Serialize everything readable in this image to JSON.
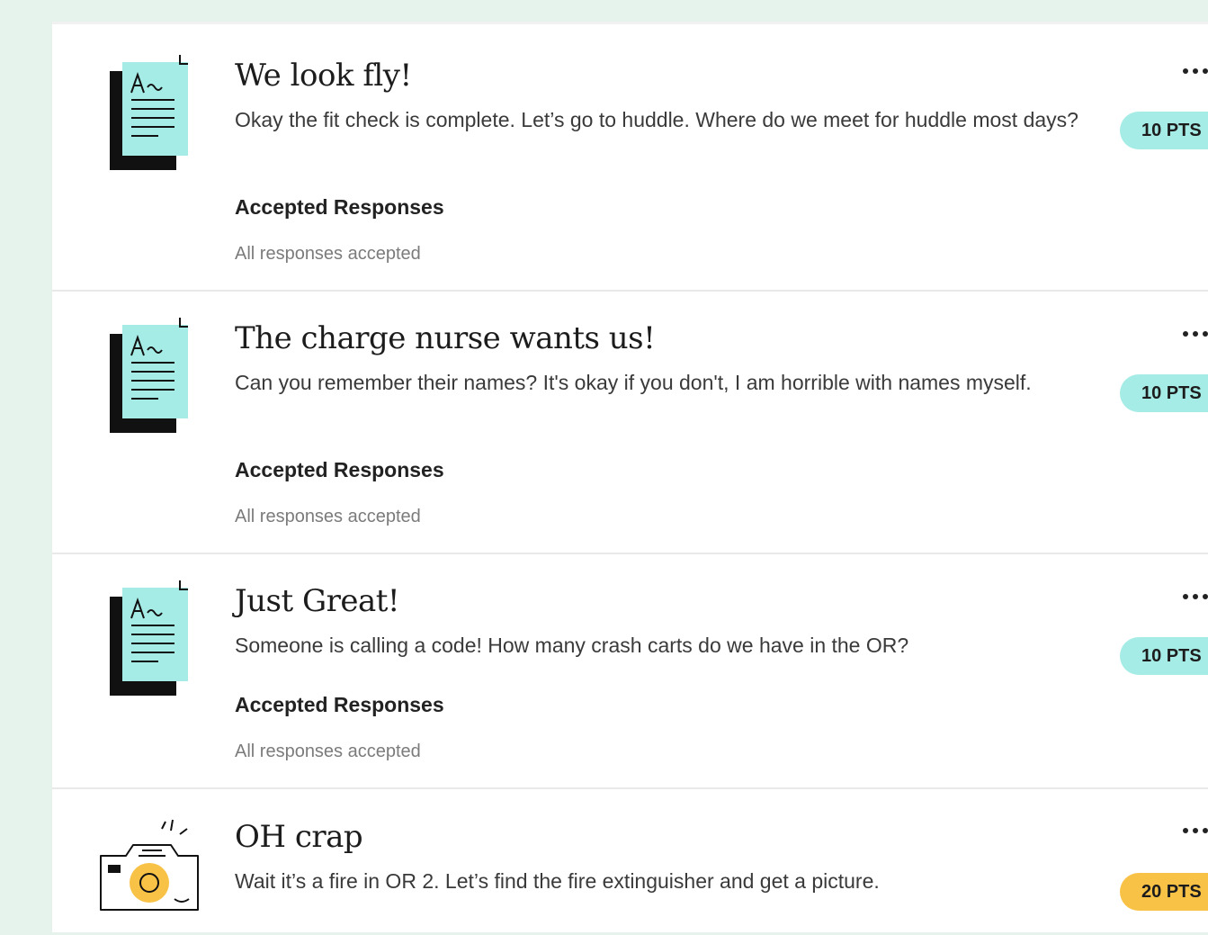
{
  "tasks": [
    {
      "title": "We look fly!",
      "description": "Okay the fit check is complete. Let’s go to huddle. Where do we meet for huddle most days?",
      "accepted_heading": "Accepted Responses",
      "accepted_text": "All responses accepted",
      "points": "10 PTS",
      "points_color": "#a6ece6",
      "icon": "document-icon"
    },
    {
      "title": "The charge nurse wants us!",
      "description": "Can you remember their names? It's okay if you don't, I am horrible with names myself.",
      "accepted_heading": "Accepted Responses",
      "accepted_text": "All responses accepted",
      "points": "10 PTS",
      "points_color": "#a6ece6",
      "icon": "document-icon"
    },
    {
      "title": "Just Great!",
      "description": "Someone is calling a code! How many crash carts do we have in the OR?",
      "accepted_heading": "Accepted Responses",
      "accepted_text": "All responses accepted",
      "points": "10 PTS",
      "points_color": "#a6ece6",
      "icon": "document-icon"
    },
    {
      "title": "OH crap",
      "description": "Wait it’s a fire in OR 2. Let’s find the fire extinguisher and get a picture.",
      "points": "20 PTS",
      "points_color": "#f8c247",
      "icon": "camera-icon"
    }
  ]
}
